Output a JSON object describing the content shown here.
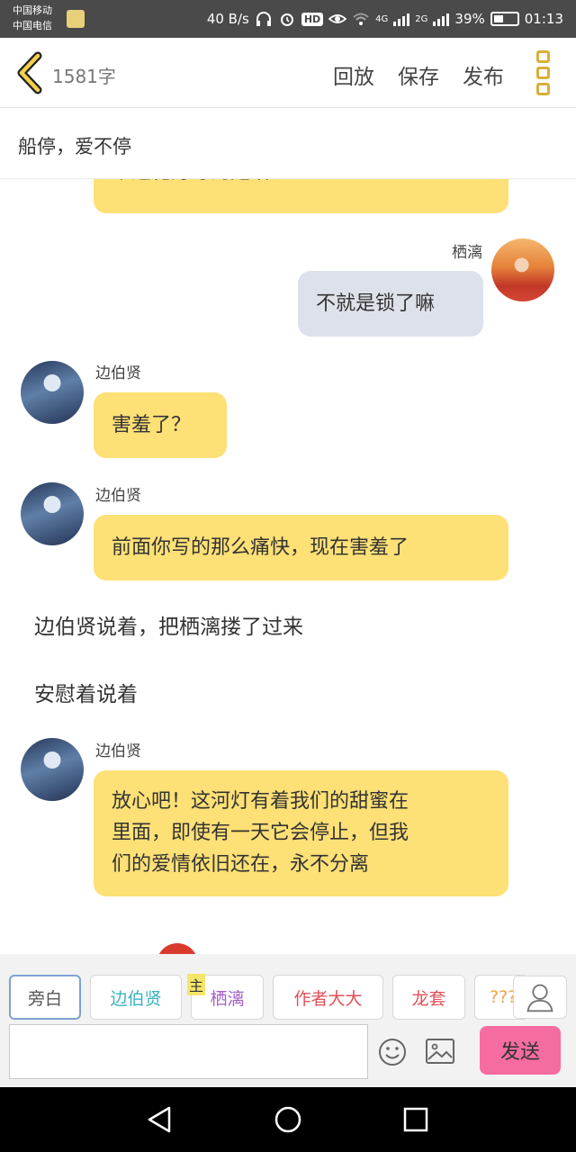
{
  "status_bar": {
    "carrier_line1": "中国移动",
    "carrier_line2": "中国电信",
    "net_speed": "40 B/s",
    "hd_label": "HD",
    "net_4g": "4G",
    "net_2g": "2G",
    "battery": "39%",
    "time": "01:13"
  },
  "header": {
    "word_count": "1581字",
    "actions": [
      "回放",
      "保存",
      "发布"
    ]
  },
  "story_title": "船停，爱不停",
  "messages": [
    {
      "type": "bubble",
      "speaker": "",
      "text": "个莲花灯写的是啥",
      "side": "left",
      "partial": true
    },
    {
      "type": "bubble",
      "speaker": "栖漓",
      "text": "不就是锁了嘛",
      "side": "right"
    },
    {
      "type": "bubble",
      "speaker": "边伯贤",
      "text": "害羞了？",
      "side": "left"
    },
    {
      "type": "bubble",
      "speaker": "边伯贤",
      "text": "前面你写的那么痛快，现在害羞了",
      "side": "left"
    },
    {
      "type": "narration",
      "text": "边伯贤说着，把栖漓搂了过来"
    },
    {
      "type": "narration",
      "text": "安慰着说着"
    },
    {
      "type": "bubble",
      "speaker": "边伯贤",
      "text_lines": [
        "放心吧！这河灯有着我们的甜蜜在",
        "里面，即使有一天它会停止，但我",
        "们的爱情依旧还在，永不分离"
      ],
      "side": "left"
    }
  ],
  "characters": [
    {
      "label": "旁白",
      "color": "#555555",
      "active": true
    },
    {
      "label": "边伯贤",
      "color": "#3bb3c3"
    },
    {
      "label": "栖漓",
      "color": "#a45ec9",
      "tag": "主"
    },
    {
      "label": "作者大大",
      "color": "#e0505a"
    },
    {
      "label": "龙套",
      "color": "#e0505a"
    },
    {
      "label": "???",
      "color": "#f0a24a"
    }
  ],
  "composer": {
    "input_value": "",
    "send_label": "发送"
  },
  "colors": {
    "accent_yellow": "#fde076",
    "bubble_grey": "#dde2ea",
    "send_pink": "#f56ca0",
    "icon_gold": "#d8b03a"
  },
  "icons": [
    "back-chevron",
    "menu-dots",
    "emoji",
    "image",
    "profile",
    "nav-back",
    "nav-home",
    "nav-recent"
  ]
}
